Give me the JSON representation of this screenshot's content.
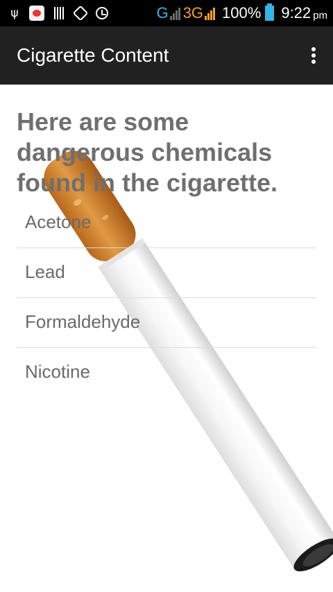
{
  "status_bar": {
    "icons": [
      "usb-icon",
      "app-notification-icon",
      "barcode-icon",
      "screen-rotate-icon",
      "alarm-icon"
    ],
    "network_g": "G",
    "network_3g": "3G",
    "battery_percent": "100%",
    "time": "9:22",
    "time_suffix": "pm",
    "colors": {
      "background": "#000000",
      "network_g": "#33b5e5",
      "network_3g": "#f0a020",
      "battery": "#33b5e5"
    }
  },
  "action_bar": {
    "title": "Cigarette Content",
    "overflow_icon": "more-vert-icon",
    "background": "#212121"
  },
  "main": {
    "headline": "Here are some dangerous chemicals found in the cigarette.",
    "chemicals": [
      {
        "label": "Acetone"
      },
      {
        "label": "Lead"
      },
      {
        "label": "Formaldehyde"
      },
      {
        "label": "Nicotine"
      }
    ],
    "background_image": "cigarette-image"
  }
}
